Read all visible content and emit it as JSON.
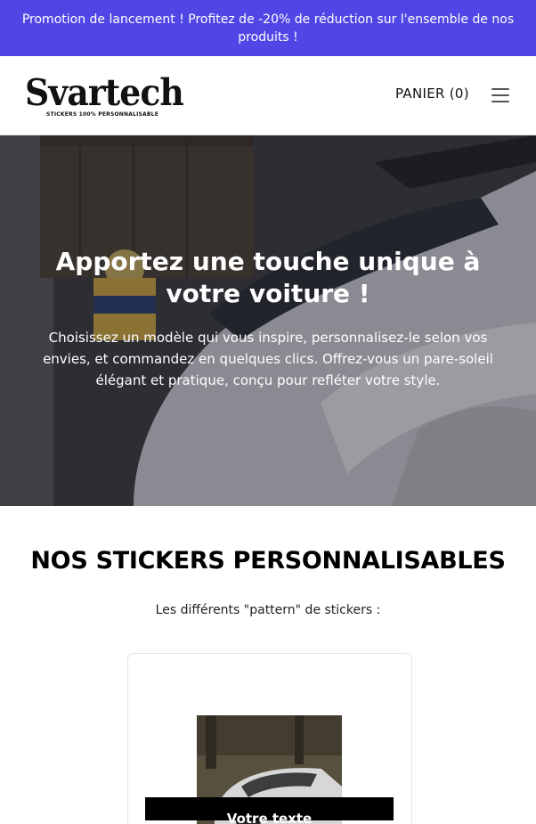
{
  "promo": {
    "text": "Promotion de lancement ! Profitez de -20% de réduction sur l'ensemble de nos produits !"
  },
  "header": {
    "logo_text": "Svartech",
    "logo_tagline": "STICKERS 100% PERSONNALISABLE",
    "cart_label": "PANIER (0)"
  },
  "hero": {
    "title": "Apportez une touche unique à votre voiture !",
    "text": "Choisissez un modèle qui vous inspire, personnalisez-le selon vos envies, et commandez en quelques clics. Offrez-vous un pare-soleil élégant et pratique, conçu pour refléter votre style."
  },
  "products_section": {
    "title": "NOS STICKERS PERSONNALISABLES",
    "subtitle": "Les différents \"pattern\" de stickers :",
    "card": {
      "preview_text": "Votre texte"
    }
  },
  "colors": {
    "promo_bg": "#4f46e5",
    "preview_banner": "#000000"
  },
  "icons": {
    "menu": "hamburger-menu-icon"
  }
}
